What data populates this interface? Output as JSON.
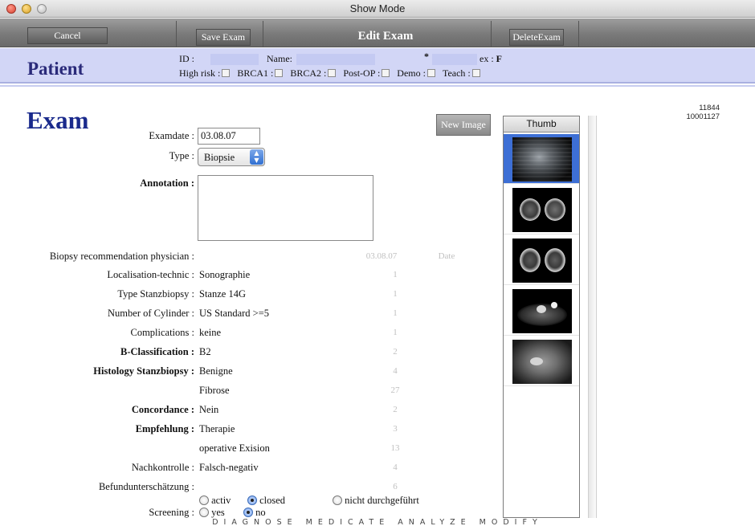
{
  "window": {
    "title": "Show Mode"
  },
  "toolbar": {
    "cancel": "Cancel",
    "save": "Save Exam",
    "title": "Edit Exam",
    "delete": "DeleteExam"
  },
  "patient": {
    "title": "Patient",
    "id_label": "ID :",
    "name_label": "Name:",
    "asterisk": "*",
    "sex_label": "ex :",
    "sex_value": "F",
    "high_risk": "High risk :",
    "brca1": "BRCA1 :",
    "brca2": "BRCA2 :",
    "post_op": "Post-OP :",
    "demo": "Demo :",
    "teach": "Teach :"
  },
  "exam": {
    "title": "Exam",
    "examdate_label": "Examdate :",
    "examdate_value": "03.08.07",
    "type_label": "Type :",
    "type_value": "Biopsie",
    "annotation_label": "Annotation :",
    "new_image": "New Image",
    "ids": [
      "11844",
      "10001127"
    ]
  },
  "rows": [
    {
      "label": "Biopsy recommendation physician :",
      "value": "",
      "num": "03.08.07",
      "extra": "Date",
      "bold": false
    },
    {
      "label": "Localisation-technic :",
      "value": "Sonographie",
      "num": "1",
      "bold": false
    },
    {
      "label": "Type Stanzbiopsy :",
      "value": "Stanze 14G",
      "num": "1",
      "bold": false
    },
    {
      "label": "Number of Cylinder :",
      "value": "US Standard >=5",
      "num": "1",
      "bold": false
    },
    {
      "label": "Complications :",
      "value": "keine",
      "num": "1",
      "bold": false
    },
    {
      "label": "B-Classification :",
      "value": "B2",
      "num": "2",
      "bold": true
    },
    {
      "label": "Histology Stanzbiopsy :",
      "value": "Benigne",
      "num": "4",
      "bold": true
    },
    {
      "label": "",
      "value": "Fibrose",
      "num": "27",
      "bold": false
    },
    {
      "label": "Concordance :",
      "value": "Nein",
      "num": "2",
      "bold": true
    },
    {
      "label": "Empfehlung :",
      "value": "Therapie",
      "num": "3",
      "bold": true
    },
    {
      "label": "",
      "value": "operative Exision",
      "num": "13",
      "bold": false
    },
    {
      "label": "Nachkontrolle :",
      "value": "Falsch-negativ",
      "num": "4",
      "bold": false
    },
    {
      "label": "Befundunterschätzung :",
      "value": "",
      "num": "6",
      "bold": false
    }
  ],
  "status_radios": {
    "activ": "activ",
    "closed": "closed",
    "nicht": "nicht durchgeführt",
    "selected": "closed"
  },
  "screening": {
    "label": "Screening :",
    "yes": "yes",
    "no": "no",
    "selected": "no"
  },
  "thumbs": {
    "header": "Thumb",
    "count": 5,
    "selected_index": 0
  },
  "footer": {
    "brand": "DIAGNOSE MEDICATE ANALYZE MODIFY"
  },
  "colors": {
    "patient_bar": "#d2d6f6",
    "exam_title": "#1a2a8c",
    "selection": "#3d6fd5"
  }
}
